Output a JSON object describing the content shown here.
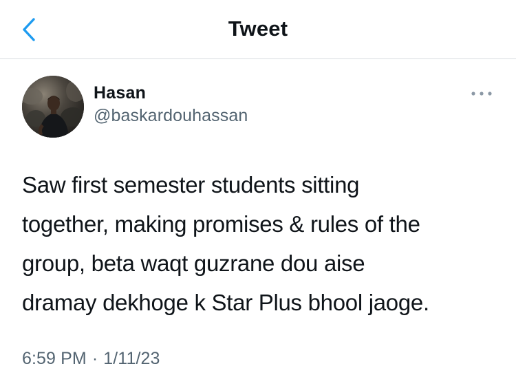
{
  "header": {
    "title": "Tweet",
    "back_icon": "chevron-left-icon",
    "accent_color": "#1d9bf0"
  },
  "author": {
    "display_name": "Hasan",
    "handle": "@baskardouhassan",
    "avatar_icon": "user-avatar-photo"
  },
  "menu": {
    "icon": "more-horizontal-icon"
  },
  "tweet": {
    "lines": [
      "Saw first semester students sitting",
      "together, making promises & rules of the",
      "group, beta waqt guzrane dou aise",
      "dramay dekhoge k Star Plus bhool jaoge."
    ],
    "time": "6:59 PM",
    "separator": "·",
    "date": "1/11/23"
  }
}
